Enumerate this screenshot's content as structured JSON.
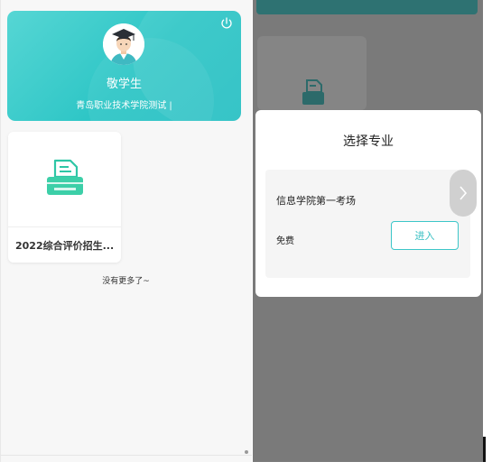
{
  "profile": {
    "name": "敬学生",
    "school": "青岛职业技术学院测试 |",
    "power_icon": "power-icon",
    "avatar_icon": "student-avatar-icon"
  },
  "exam_card": {
    "title": "2022综合评价招生...",
    "icon": "printer-icon"
  },
  "list_footer": "没有更多了~",
  "modal": {
    "title": "选择专业",
    "major": {
      "name": "信息学院第一考场",
      "price": "免费",
      "enter_label": "进入"
    },
    "arrow_icon": "chevron-right-icon"
  },
  "colors": {
    "accent": "#2ec6c6",
    "overlay": "#7a7a7a"
  }
}
